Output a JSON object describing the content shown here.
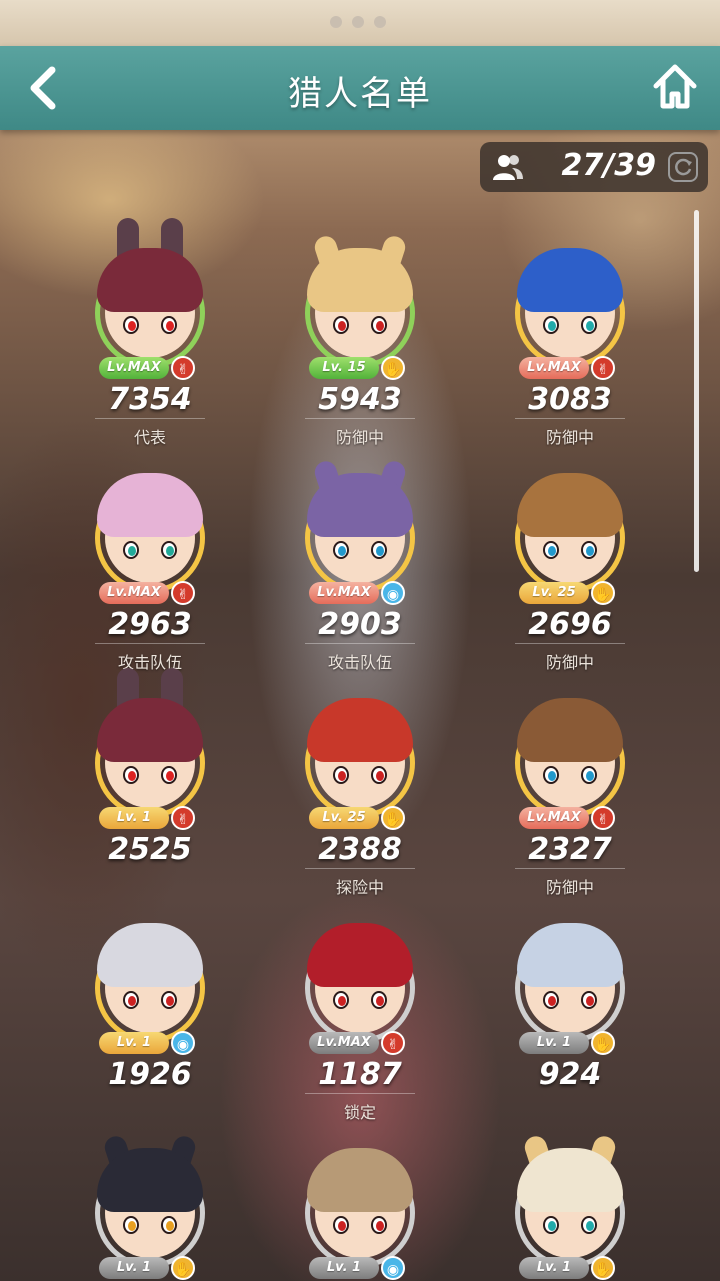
{
  "header": {
    "title": "猎人名单"
  },
  "counter": {
    "value": "27/39"
  },
  "hunters": [
    {
      "level": "Lv.MAX",
      "level_style": "green",
      "element": "red",
      "power": "7354",
      "status": "代表",
      "hair": "#7a2a3a",
      "iris": "#d22",
      "ears": "bunny"
    },
    {
      "level": "Lv. 15",
      "level_style": "green",
      "element": "gold",
      "power": "5943",
      "status": "防御中",
      "hair": "#e9c685",
      "iris": "#c22",
      "ears": "cat-gold"
    },
    {
      "level": "Lv.MAX",
      "level_style": "max",
      "element": "red",
      "power": "3083",
      "status": "防御中",
      "hair": "#2d5fc9",
      "iris": "#2aa",
      "ears": ""
    },
    {
      "level": "Lv.MAX",
      "level_style": "max",
      "element": "red",
      "power": "2963",
      "status": "攻击队伍",
      "hair": "#e6b3d6",
      "iris": "#2a9",
      "ears": ""
    },
    {
      "level": "Lv.MAX",
      "level_style": "max",
      "element": "blue",
      "power": "2903",
      "status": "攻击队伍",
      "hair": "#7b64a5",
      "iris": "#29c",
      "ears": "cat-purple"
    },
    {
      "level": "Lv. 25",
      "level_style": "",
      "element": "gold",
      "power": "2696",
      "status": "防御中",
      "hair": "#a8733e",
      "iris": "#29c",
      "ears": ""
    },
    {
      "level": "Lv. 1",
      "level_style": "",
      "element": "red",
      "power": "2525",
      "status": "",
      "hair": "#7a2a3a",
      "iris": "#d22",
      "ears": "bunny"
    },
    {
      "level": "Lv. 25",
      "level_style": "",
      "element": "gold",
      "power": "2388",
      "status": "探险中",
      "hair": "#c8382a",
      "iris": "#c22",
      "ears": ""
    },
    {
      "level": "Lv.MAX",
      "level_style": "max",
      "element": "red",
      "power": "2327",
      "status": "防御中",
      "hair": "#8a5a36",
      "iris": "#29c",
      "ears": ""
    },
    {
      "level": "Lv. 1",
      "level_style": "",
      "element": "blue",
      "power": "1926",
      "status": "",
      "hair": "#d8d8e0",
      "iris": "#c22",
      "ears": ""
    },
    {
      "level": "Lv.MAX",
      "level_style": "grey",
      "element": "red",
      "power": "1187",
      "status": "锁定",
      "hair": "#b21e2a",
      "iris": "#c22",
      "ears": ""
    },
    {
      "level": "Lv. 1",
      "level_style": "grey",
      "element": "gold",
      "power": "924",
      "status": "",
      "hair": "#c6d2e4",
      "iris": "#c22",
      "ears": ""
    },
    {
      "level": "Lv. 1",
      "level_style": "grey",
      "element": "gold",
      "power": "",
      "status": "",
      "hair": "#2a2a36",
      "iris": "#e9a020",
      "ears": "cat-dark"
    },
    {
      "level": "Lv. 1",
      "level_style": "grey",
      "element": "blue",
      "power": "",
      "status": "",
      "hair": "#b79a76",
      "iris": "#c22",
      "ears": ""
    },
    {
      "level": "Lv. 1",
      "level_style": "grey",
      "element": "gold",
      "power": "",
      "status": "",
      "hair": "#efe5d0",
      "iris": "#2aa",
      "ears": "cat-gold"
    }
  ],
  "colors": {
    "header_teal": "#4f9895",
    "level_gold": "#eaa63a",
    "level_green": "#52b23a"
  }
}
